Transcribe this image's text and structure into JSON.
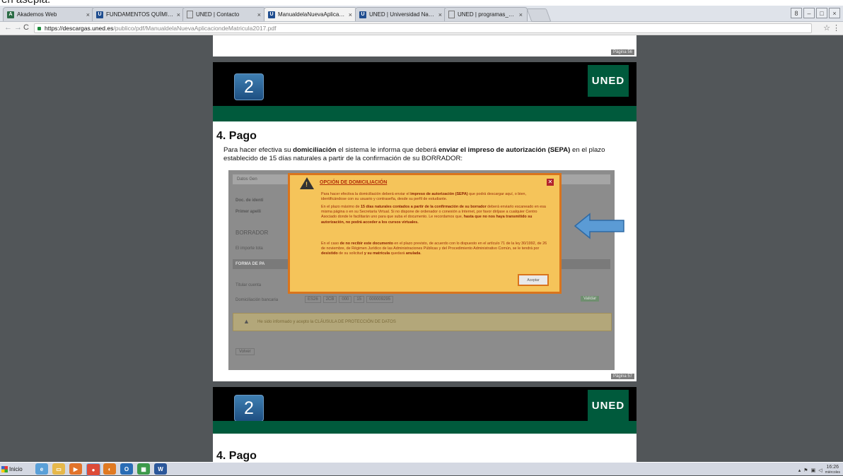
{
  "caption_fragment": "en asepia.",
  "browser": {
    "tabs": [
      {
        "label": "Akademos Web",
        "favicon": "green",
        "active": false
      },
      {
        "label": "FUNDAMENTOS QUÍMICOS",
        "favicon": "blue",
        "active": false
      },
      {
        "label": "UNED | Contacto",
        "favicon": "doc",
        "active": false
      },
      {
        "label": "ManualdelaNuevaAplicacion",
        "favicon": "blue",
        "active": true
      },
      {
        "label": "UNED | Universidad Nacion",
        "favicon": "blue",
        "active": false
      },
      {
        "label": "UNED | programas_doctora",
        "favicon": "doc",
        "active": false
      }
    ],
    "url_host": "https://descargas.uned.es",
    "url_path": "/publico/pdf/ManualdelaNuevaAplicaciondeMatricula2017.pdf",
    "colors": {
      "uned_green": "#005a3c",
      "modal_orange": "#d9741c",
      "arrow_blue": "#5b9bd5"
    }
  },
  "pdf": {
    "page_label_prev": "Página 56",
    "page_label_cur": "Página 57",
    "section_badge": "2",
    "logo_text": "UNED",
    "section_heading": "4. Pago",
    "intro_1": "Para hacer efectiva su ",
    "intro_b1": "domiciliación",
    "intro_2": " el sistema le informa que deberá ",
    "intro_b2": "enviar el impreso de autorización (SEPA)",
    "intro_3": " en el plazo establecido de 15 días naturales a partir de la confirmación de su BORRADOR:",
    "next_section_badge": "2",
    "next_logo_text": "UNED",
    "next_heading": "4. Pago"
  },
  "screenshot": {
    "bg_labels": [
      "Datos Gen",
      "Doc. de identi",
      "Primer apelli",
      "BORRADOR",
      "El importe tota",
      "FORMA DE PA",
      "Titular cuenta",
      "Domiciliación bancaria"
    ],
    "iban_values": [
      "ES26",
      "2CB",
      "000",
      "15",
      "000009295"
    ],
    "bg_button": "Validar",
    "bg_check_text": "He sido informado y acepto la CLÁUSULA DE PROTECCIÓN DE DATOS",
    "bg_back": "Volver",
    "modal_title": "OPCIÓN DE DOMICILIACIÓN",
    "p1_a": "Para hacer efectiva la domiciliación deberá enviar el ",
    "p1_b": "impreso de autorización (SEPA)",
    "p1_c": " que podrá descargar aquí, o bien, identificándose con su usuario y contraseña, desde su perfil de estudiante.",
    "p2_a": "En el plazo máximo de ",
    "p2_b": "15 días naturales contados a partir de la confirmación de su borrador",
    "p2_c": " deberá enviarlo escaneado en esa misma página o en su Secretaría Virtual. Si no dispone de ordenador o conexión a Internet, por favor diríjase a cualquier Centro Asociado donde le facilitarán uno para que suba el documento. Le recordamos que, ",
    "p2_d": "hasta que no nos haya transmitido su autorización, no podrá acceder a los cursos virtuales.",
    "p3_a": "En el caso ",
    "p3_b": "de no recibir este documento",
    "p3_c": " en el plazo previsto, de acuerdo con lo dispuesto en el artículo 71 de la ley 30/1992, de 26 de noviembre, de Régimen Jurídico de las Administraciones Públicas y del Procedimiento Administrativo Común, se le tendrá por ",
    "p3_d": "desistido",
    "p3_e": " de su solicitud ",
    "p3_f": "y su matrícula",
    "p3_g": " quedará ",
    "p3_h": "anulada",
    "p3_i": ".",
    "accept_label": "Aceptar"
  },
  "taskbar": {
    "start_label": "Inicio",
    "clock_time": "16:26",
    "clock_day": "miércoles"
  }
}
